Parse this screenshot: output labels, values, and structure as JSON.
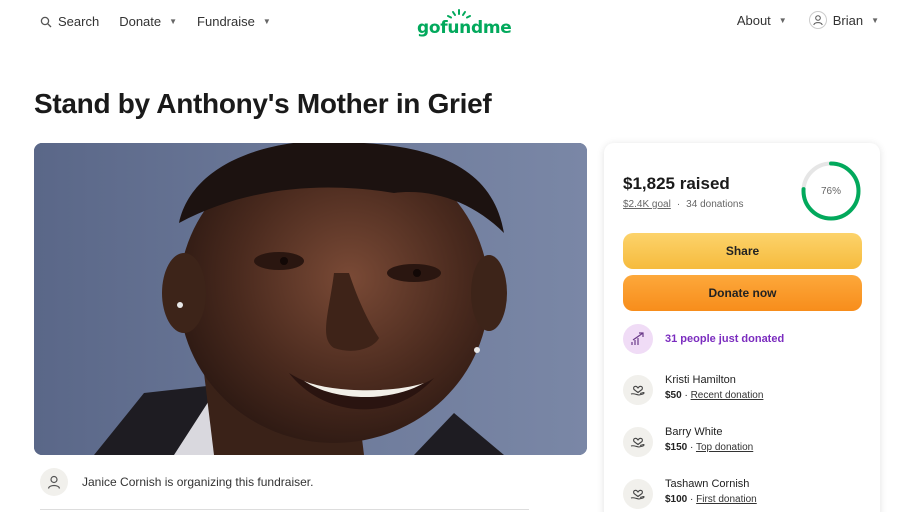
{
  "nav": {
    "search": "Search",
    "donate": "Donate",
    "fundraise": "Fundraise",
    "logo": "gofundme",
    "about": "About",
    "user": "Brian"
  },
  "page": {
    "title": "Stand by Anthony's Mother in Grief"
  },
  "organizer": {
    "text": "Janice Cornish is organizing this fundraiser."
  },
  "card": {
    "raised": "$1,825 raised",
    "goal": "$2.4K goal",
    "separator": "·",
    "donations": "34 donations",
    "progress_label": "76%",
    "progress": 0.76,
    "share": "Share",
    "donate_now": "Donate now",
    "just_donated": "31 people just donated"
  },
  "donors": [
    {
      "name": "Kristi Hamilton",
      "amount": "$50",
      "tag": "Recent donation"
    },
    {
      "name": "Barry White",
      "amount": "$150",
      "tag": "Top donation"
    },
    {
      "name": "Tashawn Cornish",
      "amount": "$100",
      "tag": "First donation"
    }
  ],
  "colors": {
    "brand": "#02a95c",
    "share": "#f6bb3d",
    "donate": "#f78d1b",
    "accent_purple": "#7b2cbf"
  }
}
